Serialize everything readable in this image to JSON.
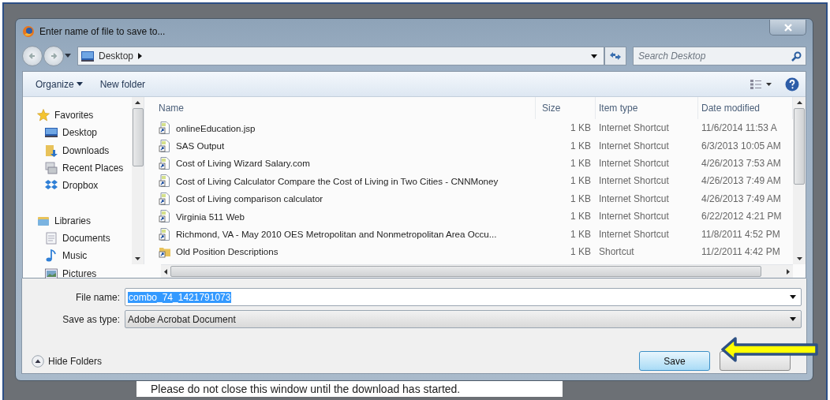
{
  "window": {
    "title": "Enter name of file to save to..."
  },
  "address_bar": {
    "location": "Desktop"
  },
  "search": {
    "placeholder": "Search Desktop"
  },
  "toolbar": {
    "organize": "Organize",
    "new_folder": "New folder"
  },
  "nav_pane": {
    "groups": [
      {
        "label": "Favorites",
        "kind": "favorites",
        "children": [
          {
            "label": "Desktop",
            "kind": "desktop"
          },
          {
            "label": "Downloads",
            "kind": "downloads"
          },
          {
            "label": "Recent Places",
            "kind": "recent"
          },
          {
            "label": "Dropbox",
            "kind": "dropbox"
          }
        ]
      },
      {
        "label": "Libraries",
        "kind": "libraries",
        "children": [
          {
            "label": "Documents",
            "kind": "documents"
          },
          {
            "label": "Music",
            "kind": "music"
          },
          {
            "label": "Pictures",
            "kind": "pictures"
          }
        ]
      }
    ]
  },
  "file_list": {
    "columns": [
      "Name",
      "Size",
      "Item type",
      "Date modified"
    ],
    "rows": [
      {
        "name": "onlineEducation.jsp",
        "size": "1 KB",
        "type": "Internet Shortcut",
        "date": "11/6/2014 11:53 A",
        "kind": "link"
      },
      {
        "name": "SAS Output",
        "size": "1 KB",
        "type": "Internet Shortcut",
        "date": "6/3/2013 10:05 AM",
        "kind": "link"
      },
      {
        "name": "Cost of Living Wizard Salary.com",
        "size": "1 KB",
        "type": "Internet Shortcut",
        "date": "4/26/2013 7:53 AM",
        "kind": "link"
      },
      {
        "name": "Cost of Living Calculator Compare the Cost of Living in Two Cities - CNNMoney",
        "size": "1 KB",
        "type": "Internet Shortcut",
        "date": "4/26/2013 7:49 AM",
        "kind": "link"
      },
      {
        "name": "Cost of Living comparison calculator",
        "size": "1 KB",
        "type": "Internet Shortcut",
        "date": "4/26/2013 7:49 AM",
        "kind": "link"
      },
      {
        "name": "Virginia 511 Web",
        "size": "1 KB",
        "type": "Internet Shortcut",
        "date": "6/22/2012 4:21 PM",
        "kind": "link"
      },
      {
        "name": "Richmond, VA - May 2010 OES Metropolitan and Nonmetropolitan Area Occu...",
        "size": "1 KB",
        "type": "Internet Shortcut",
        "date": "11/8/2011 4:52 PM",
        "kind": "link"
      },
      {
        "name": "Old Position Descriptions",
        "size": "1 KB",
        "type": "Shortcut",
        "date": "11/2/2011 4:42 PM",
        "kind": "folder"
      }
    ]
  },
  "file_name": {
    "label": "File name:",
    "value": "combo_74_1421791073",
    "text_selected": true
  },
  "save_as_type": {
    "label": "Save as type:",
    "value": "Adobe Acrobat Document"
  },
  "hide_folders": "Hide Folders",
  "buttons": [
    {
      "label": "Save",
      "kind": "default"
    },
    {
      "kind": "plain"
    }
  ],
  "annotation": {
    "kind": "arrow"
  },
  "background_page": {
    "message": "Please do not close this window until the download has started."
  }
}
